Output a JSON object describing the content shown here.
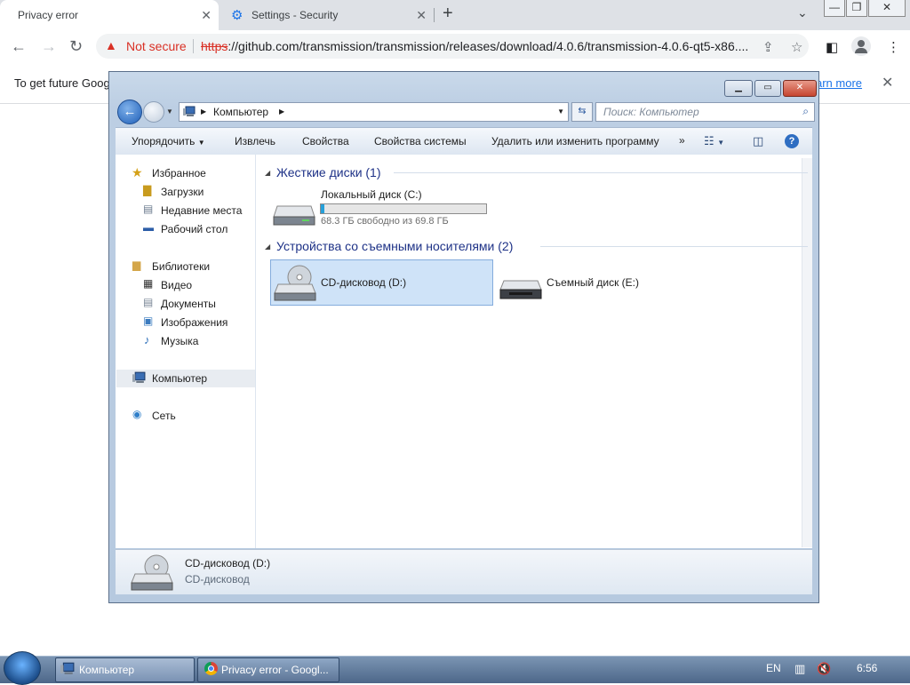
{
  "browser": {
    "tabs": [
      {
        "title": "Privacy error",
        "active": true
      },
      {
        "title": "Settings - Security",
        "active": false
      }
    ],
    "security_label": "Not secure",
    "url_scheme": "https",
    "url_rest": "://github.com/transmission/transmission/releases/download/4.0.6/transmission-4.0.6-qt5-x86....",
    "infobar_text": "To get future Goog",
    "infobar_link": "arn more"
  },
  "explorer": {
    "address": {
      "location": "Компьютер"
    },
    "search_placeholder": "Поиск: Компьютер",
    "commands": [
      "Упорядочить",
      "Извлечь",
      "Свойства",
      "Свойства системы",
      "Удалить или изменить программу"
    ],
    "nav": {
      "favorites": {
        "label": "Избранное",
        "items": [
          "Загрузки",
          "Недавние места",
          "Рабочий стол"
        ]
      },
      "libraries": {
        "label": "Библиотеки",
        "items": [
          "Видео",
          "Документы",
          "Изображения",
          "Музыка"
        ]
      },
      "computer": "Компьютер",
      "network": "Сеть"
    },
    "groups": {
      "hard_disks": {
        "title": "Жесткие диски (1)"
      },
      "removable": {
        "title": "Устройства со съемными носителями (2)"
      }
    },
    "drives": {
      "c": {
        "name": "Локальный диск (C:)",
        "free": "68.3 ГБ свободно из 69.8 ГБ",
        "used_fraction": 0.021
      },
      "d": {
        "name": "CD-дисковод (D:)"
      },
      "e": {
        "name": "Съемный диск (E:)"
      }
    },
    "details": {
      "name": "CD-дисковод (D:)",
      "type": "CD-дисковод"
    }
  },
  "taskbar": {
    "items": [
      "Компьютер",
      "Privacy error - Googl..."
    ],
    "lang": "EN",
    "time": "6:56"
  }
}
